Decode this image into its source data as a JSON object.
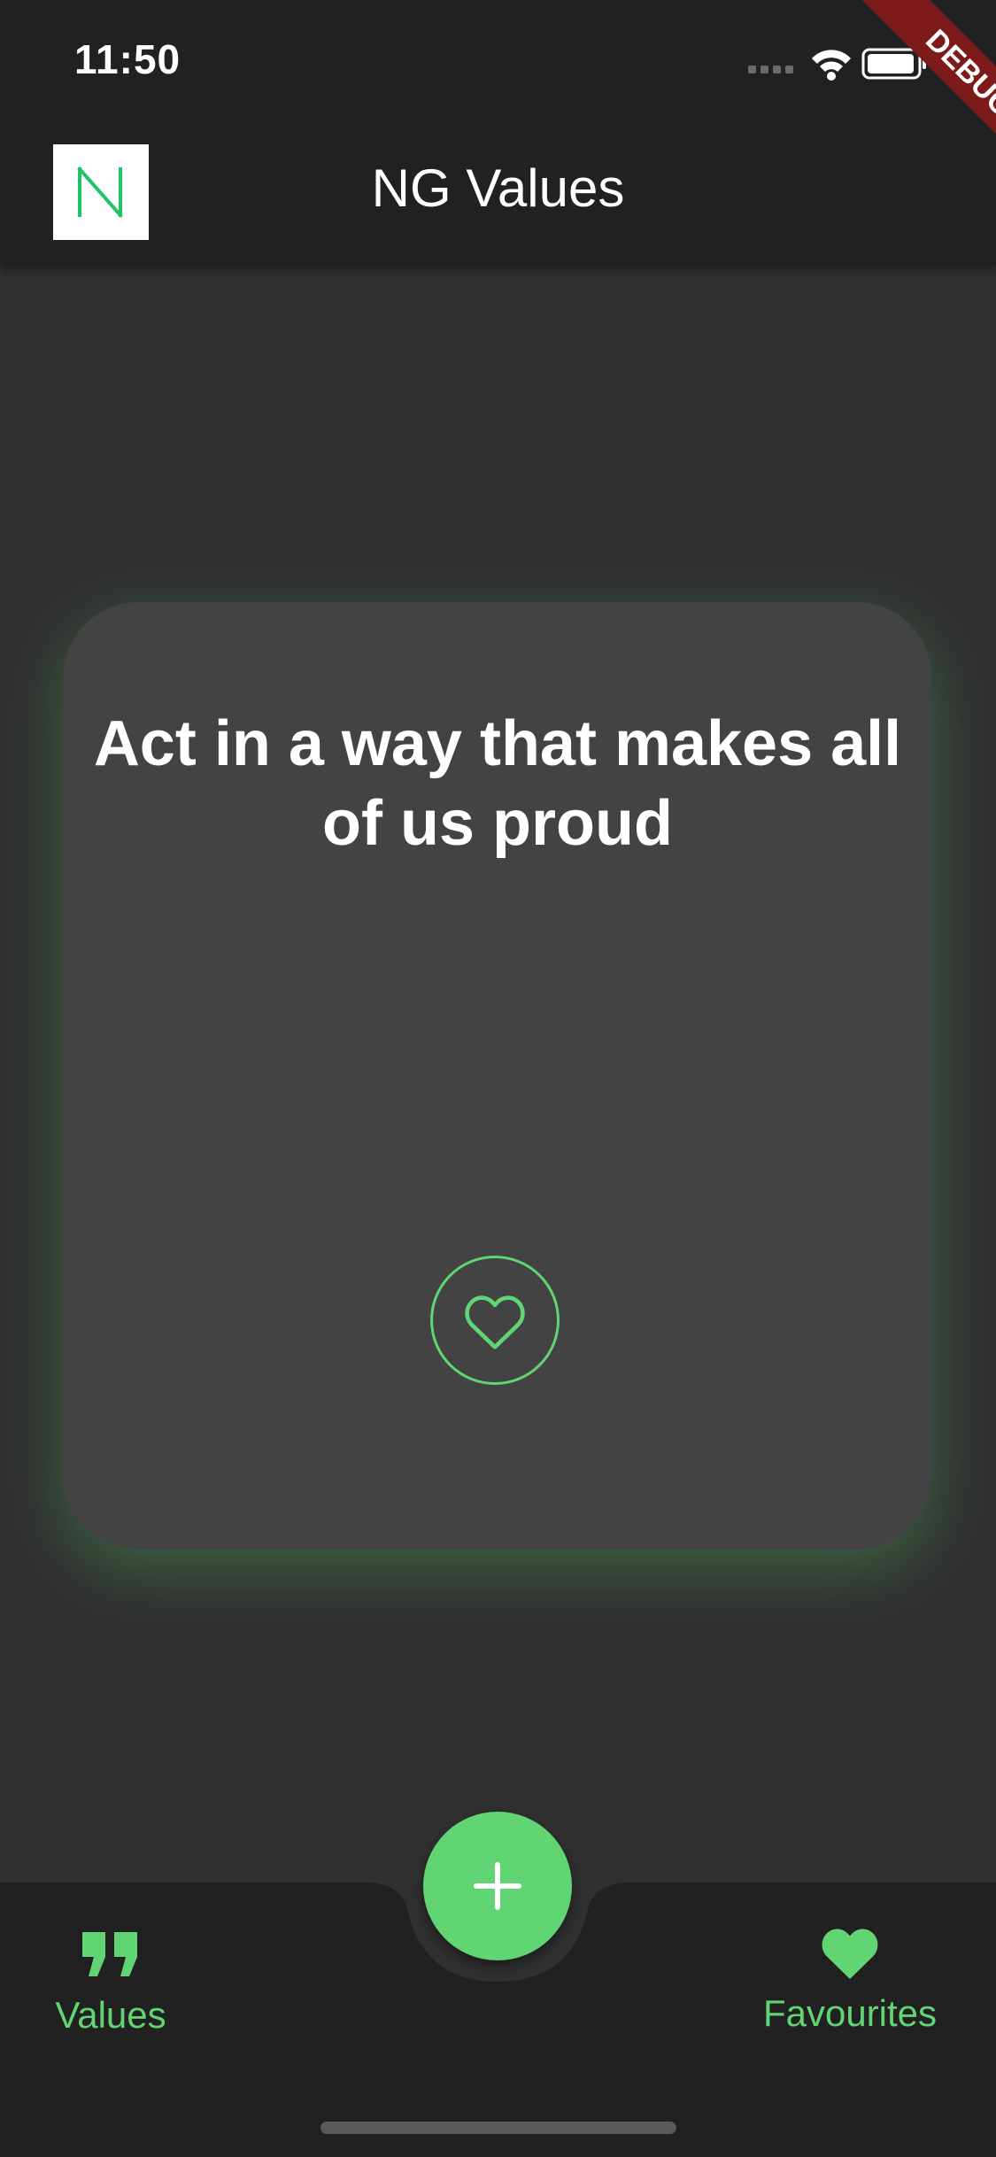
{
  "status_bar": {
    "time": "11:50"
  },
  "debug_banner": {
    "label": "DEBUG"
  },
  "app_bar": {
    "title": "NG Values",
    "logo_icon": "ng-logo-icon",
    "logo_color": "#1fc46a"
  },
  "card": {
    "text": "Act in a way that makes all of us proud",
    "favorite_icon": "heart-outline-icon"
  },
  "fab": {
    "icon": "plus-icon"
  },
  "bottom_nav": {
    "items": [
      {
        "label": "Values",
        "icon": "quote-icon"
      },
      {
        "label": "Favourites",
        "icon": "heart-icon"
      }
    ]
  },
  "colors": {
    "accent": "#61d473",
    "background": "#303030",
    "bar": "#212121",
    "card": "#434343",
    "debug": "#7d1a1a"
  }
}
